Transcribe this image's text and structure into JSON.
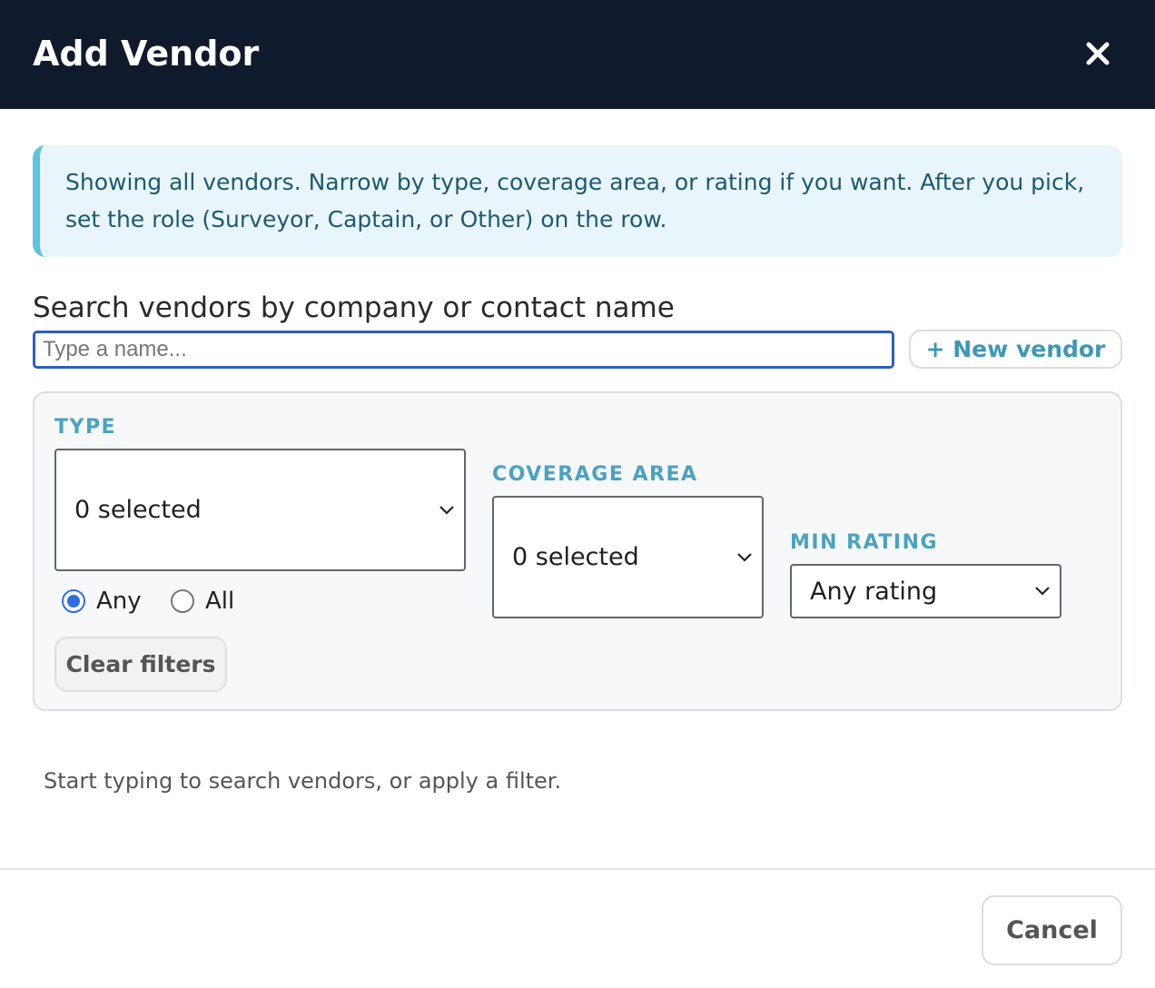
{
  "modal": {
    "title": "Add Vendor",
    "close_icon": "close-icon"
  },
  "info": {
    "text": "Showing all vendors. Narrow by type, coverage area, or rating if you want. After you pick, set the role (Surveyor, Captain, or Other) on the row."
  },
  "search": {
    "label": "Search vendors by company or contact name",
    "placeholder": "Type a name...",
    "value": "",
    "new_vendor_label": "+ New vendor"
  },
  "filters": {
    "type": {
      "label": "TYPE",
      "value": "0 selected",
      "match_options": [
        {
          "label": "Any",
          "selected": true
        },
        {
          "label": "All",
          "selected": false
        }
      ]
    },
    "coverage": {
      "label": "COVERAGE AREA",
      "value": "0 selected"
    },
    "rating": {
      "label": "MIN RATING",
      "value": "Any rating"
    },
    "clear_label": "Clear filters"
  },
  "results": {
    "hint": "Start typing to search vendors, or apply a filter."
  },
  "footer": {
    "cancel_label": "Cancel"
  },
  "colors": {
    "header_bg": "#0f1a2c",
    "accent": "#4aa3bf",
    "info_bg": "#e8f6fb",
    "radio_on": "#2f6fe0",
    "input_focus": "#2c5fbf"
  }
}
